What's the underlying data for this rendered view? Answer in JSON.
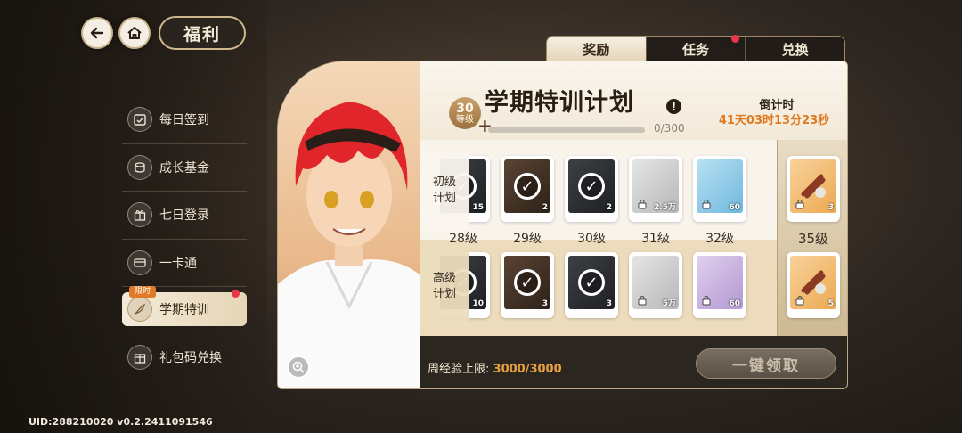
{
  "header": {
    "title": "福利"
  },
  "nav": {
    "back_icon": "arrow-left-icon",
    "home_icon": "home-icon"
  },
  "menu": {
    "items": [
      {
        "label": "每日签到",
        "icon": "calendar-check-icon"
      },
      {
        "label": "成长基金",
        "icon": "coins-icon"
      },
      {
        "label": "七日登录",
        "icon": "gift-box-icon"
      },
      {
        "label": "一卡通",
        "icon": "card-icon"
      },
      {
        "label": "学期特训",
        "icon": "quill-icon",
        "tag": "限时"
      },
      {
        "label": "礼包码兑换",
        "icon": "gift-code-icon"
      }
    ]
  },
  "tabs": [
    {
      "label": "奖励"
    },
    {
      "label": "任务"
    },
    {
      "label": "兑换"
    }
  ],
  "plan": {
    "title": "学期特训计划",
    "level_number": "30",
    "level_label": "等级",
    "xp_text": "0/300",
    "xp_progress": 0,
    "countdown_label": "倒计时",
    "countdown": "41天03时13分23秒"
  },
  "rows": {
    "basic_label": "初级\n计划",
    "advanced_label": "高级\n计划"
  },
  "levels": [
    "28级",
    "29级",
    "30级",
    "31级",
    "32级"
  ],
  "milestone_level": "35级",
  "basic_rewards": [
    {
      "qty": "15",
      "claimed": true,
      "rarity": "dark"
    },
    {
      "qty": "2",
      "claimed": true,
      "rarity": "brown"
    },
    {
      "qty": "2",
      "claimed": true,
      "rarity": "dark"
    },
    {
      "qty": "2.5万",
      "claimed": false,
      "rarity": "grey"
    },
    {
      "qty": "60",
      "claimed": false,
      "rarity": "blue"
    }
  ],
  "advanced_rewards": [
    {
      "qty": "10",
      "claimed": true,
      "rarity": "dark"
    },
    {
      "qty": "3",
      "claimed": true,
      "rarity": "brown"
    },
    {
      "qty": "3",
      "claimed": true,
      "rarity": "dark"
    },
    {
      "qty": "5万",
      "claimed": false,
      "rarity": "grey"
    },
    {
      "qty": "60",
      "claimed": false,
      "rarity": "purple"
    }
  ],
  "milestone_rewards": {
    "basic_qty": "3",
    "advanced_qty": "5"
  },
  "footer": {
    "weekly_label": "周经验上限:",
    "weekly_value": "3000/3000",
    "claim_all": "一键领取"
  },
  "uid": "UID:288210020 v0.2.2411091546",
  "colors": {
    "accent_orange": "#e07a20",
    "notify_red": "#e8364a",
    "gold": "#b8904f"
  }
}
